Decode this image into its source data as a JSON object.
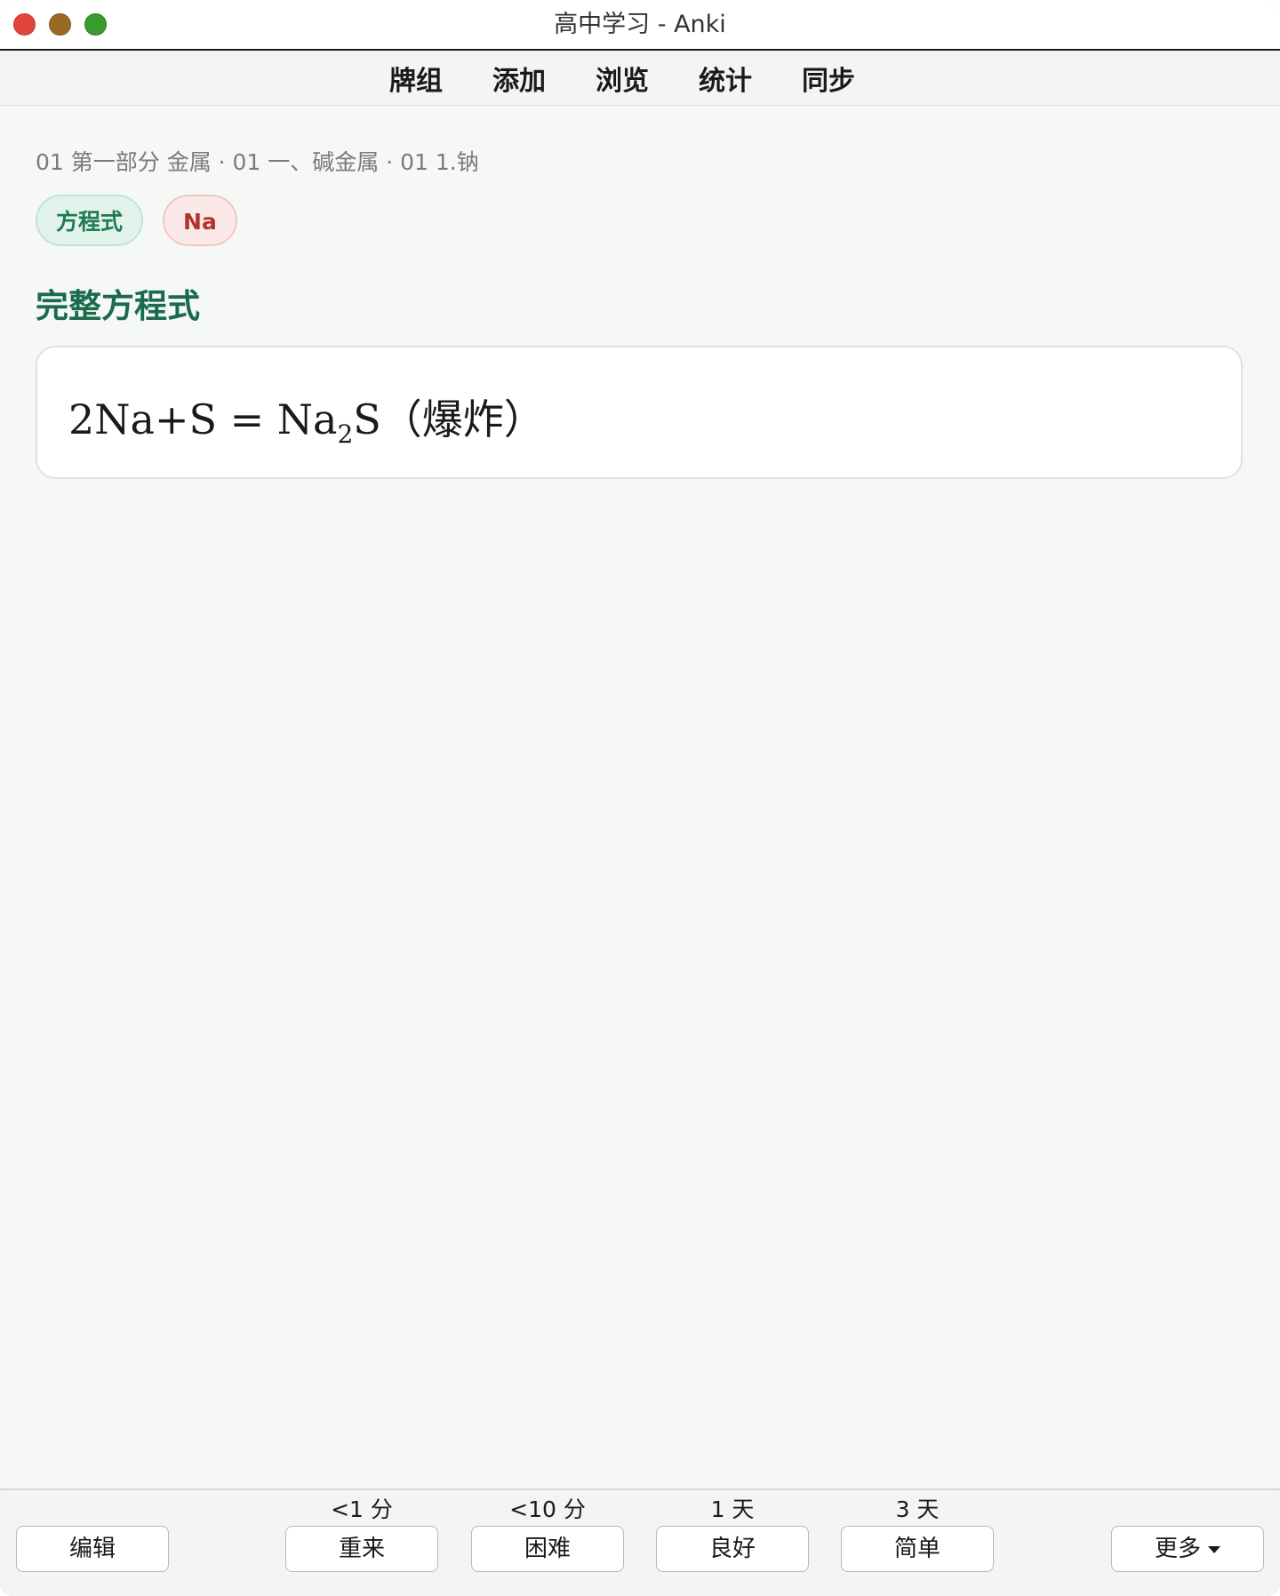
{
  "window": {
    "title": "高中学习 - Anki"
  },
  "toolbar": {
    "items": [
      "牌组",
      "添加",
      "浏览",
      "统计",
      "同步"
    ]
  },
  "card": {
    "breadcrumb": "01 第一部分 金属 · 01 一、碱金属 · 01 1.钠",
    "tags": [
      "方程式",
      "Na"
    ],
    "section_title": "完整方程式",
    "formula": {
      "part1": "2Na+S = Na",
      "subscript": "2",
      "part2": "S（爆炸）"
    }
  },
  "answer_bar": {
    "edit_label": "编辑",
    "more_label": "更多",
    "ratings": [
      {
        "label": "重来",
        "interval": "<1 分"
      },
      {
        "label": "困难",
        "interval": "<10 分"
      },
      {
        "label": "良好",
        "interval": "1 天"
      },
      {
        "label": "简单",
        "interval": "3 天"
      }
    ]
  },
  "colors": {
    "accent_green": "#1a6b4c",
    "tag_green_bg": "#e2f3ec",
    "tag_red_bg": "#fbe9e7",
    "tag_red_text": "#b2332a"
  }
}
